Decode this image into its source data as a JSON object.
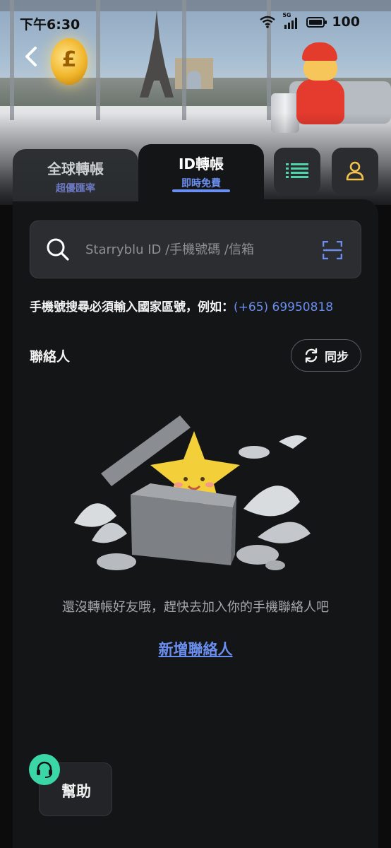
{
  "status_bar": {
    "time": "下午6:30",
    "network": "5G",
    "battery": "100"
  },
  "tabs": [
    {
      "title": "全球轉帳",
      "subtitle": "超優匯率"
    },
    {
      "title": "ID轉帳",
      "subtitle": "即時免費"
    }
  ],
  "icons": {
    "back": "back-arrow-icon",
    "list": "list-icon",
    "user": "user-icon",
    "search": "search-icon",
    "scan": "scan-icon",
    "sync": "sync-icon",
    "support": "headset-icon"
  },
  "search": {
    "placeholder": "Starryblu ID /手機號碼 /信箱",
    "value": ""
  },
  "hint": {
    "text": "手機號搜尋必須輸入國家區號，例如：",
    "example": "(+65) 69950818"
  },
  "contacts": {
    "label": "聯絡人",
    "sync_label": "同步"
  },
  "empty_state": {
    "message": "還沒轉帳好友哦，趕快去加入你的手機聯絡人吧",
    "add_label": "新增聯絡人"
  },
  "help": {
    "label": "幫助"
  },
  "colors": {
    "accent": "#6b8ff0",
    "support": "#3ad6a6",
    "icon_green": "#4fd3a7",
    "icon_gold": "#f2c14e"
  }
}
